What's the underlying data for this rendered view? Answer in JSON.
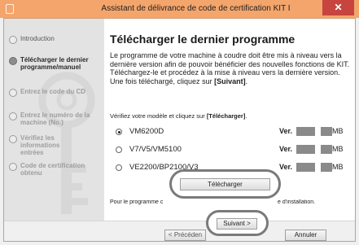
{
  "window": {
    "title": "Assistant de délivrance de code de certification KIT I",
    "close_glyph": "✕"
  },
  "sidebar": {
    "items": [
      {
        "label": "Introduction",
        "state": "done"
      },
      {
        "label": "Télécharger le dernier programme/manuel",
        "state": "active"
      },
      {
        "label": "Entrez le code du CD",
        "state": "pending"
      },
      {
        "label": "Entrez le numéro de la machine (No.)",
        "state": "pending"
      },
      {
        "label": "Vérifiez les informations entrées",
        "state": "pending"
      },
      {
        "label": "Code de certification obtenu",
        "state": "pending"
      }
    ]
  },
  "main": {
    "heading": "Télécharger le dernier programme",
    "desc_text": "Le programme de votre machine à coudre doit être mis à niveau vers la dernière version afin de pouvoir bénéficier des nouvelles fonctions de KIT. Téléchargez-le et procédez à la mise à niveau vers la dernière version.",
    "desc_line2_prefix": "Une fois téléchargé, cliquez sur ",
    "desc_line2_bold": "[Suivant]",
    "desc_line2_suffix": ".",
    "instruction_prefix": "Vérifiez votre modèle et cliquez sur ",
    "instruction_bold": "[Télécharger]",
    "instruction_suffix": ".",
    "models": [
      {
        "name": "VM6200D",
        "selected": true,
        "ver_label": "Ver.",
        "unit": "MB"
      },
      {
        "name": "V7/V5/VM5100",
        "selected": false,
        "ver_label": "Ver.",
        "unit": "MB"
      },
      {
        "name": "VE2200/BP2100/V3",
        "selected": false,
        "ver_label": "Ver.",
        "unit": "MB"
      }
    ],
    "download_button": "Télécharger",
    "footnote_before": "Pour le programme c",
    "footnote_after": "e d'installation."
  },
  "footer": {
    "prev_button": "< Précéden",
    "next_button": "Suivant >",
    "cancel_button": "Annuler"
  },
  "colors": {
    "titlebar": "#f4a56c",
    "close_button": "#c7443f",
    "sidebar_bg": "#e3e3e3",
    "highlight_ring": "#7a7a7a"
  },
  "icons": {
    "app": "app-icon",
    "close": "close-icon",
    "watermark": "key-watermark-icon"
  }
}
